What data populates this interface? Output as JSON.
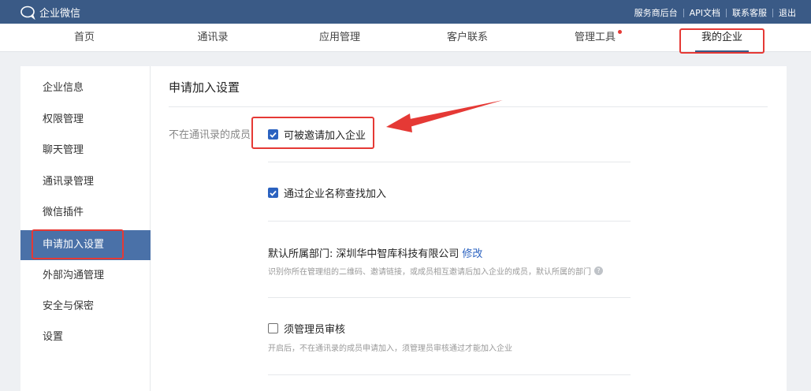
{
  "topbar": {
    "brand": "企业微信",
    "links": [
      "服务商后台",
      "API文档",
      "联系客服",
      "退出"
    ]
  },
  "nav": {
    "tabs": [
      "首页",
      "通讯录",
      "应用管理",
      "客户联系",
      "管理工具",
      "我的企业"
    ],
    "active_index": 5
  },
  "sidebar": {
    "items": [
      "企业信息",
      "权限管理",
      "聊天管理",
      "通讯录管理",
      "微信插件",
      "申请加入设置",
      "外部沟通管理",
      "安全与保密",
      "设置"
    ],
    "active_index": 5
  },
  "content": {
    "title": "申请加入设置",
    "row_label": "不在通讯录的成员",
    "option_invite": {
      "label": "可被邀请加入企业",
      "checked": true
    },
    "option_search": {
      "label": "通过企业名称查找加入",
      "checked": true
    },
    "dept_label": "默认所属部门:",
    "dept_value": "深圳华中智库科技有限公司",
    "dept_edit": "修改",
    "dept_hint": "识别你所在管理组的二维码、邀请链接，或成员相互邀请后加入企业的成员，默认所属的部门",
    "help_glyph": "?",
    "option_review": {
      "label": "须管理员审核",
      "checked": false
    },
    "review_hint": "开启后，不在通讯录的成员申请加入，须管理员审核通过才能加入企业"
  },
  "colors": {
    "topbar": "#3a5a86",
    "accent": "#2b62c0",
    "sidebar_active": "#4a71a8",
    "annotation": "#e53935"
  }
}
